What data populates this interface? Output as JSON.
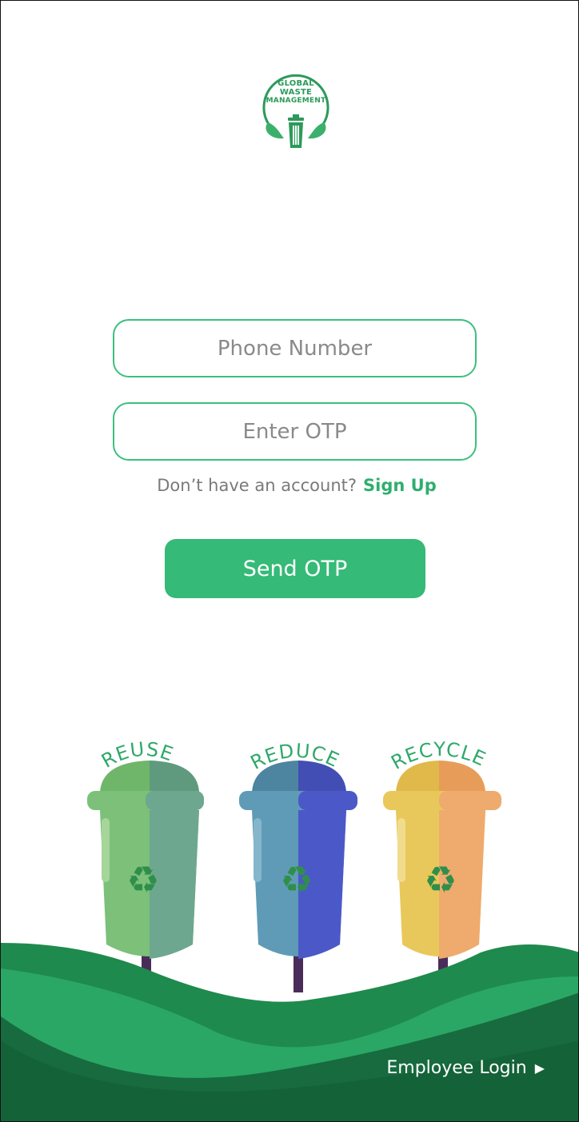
{
  "logo": {
    "line1": "GLOBAL",
    "line2": "WASTE",
    "line3": "MANAGEMENT",
    "icon": "trash-leaf-icon"
  },
  "form": {
    "phone_placeholder": "Phone Number",
    "otp_placeholder": "Enter OTP",
    "no_account_text": "Don’t have an account?",
    "signup_label": "Sign Up",
    "send_otp_label": "Send OTP"
  },
  "bins": [
    {
      "label": "REUSE",
      "color_left": "#7cc07a",
      "color_right": "#6ea78f"
    },
    {
      "label": "REDUCE",
      "color_left": "#5f9bb6",
      "color_right": "#4b59c8"
    },
    {
      "label": "RECYCLE",
      "color_left": "#e8c85a",
      "color_right": "#efaa6e"
    }
  ],
  "footer": {
    "employee_login_label": "Employee Login",
    "arrow_icon": "caret-right-icon"
  },
  "colors": {
    "brand_green": "#35ba77",
    "dark_green": "#176b3f",
    "link_green": "#2fae6e"
  }
}
